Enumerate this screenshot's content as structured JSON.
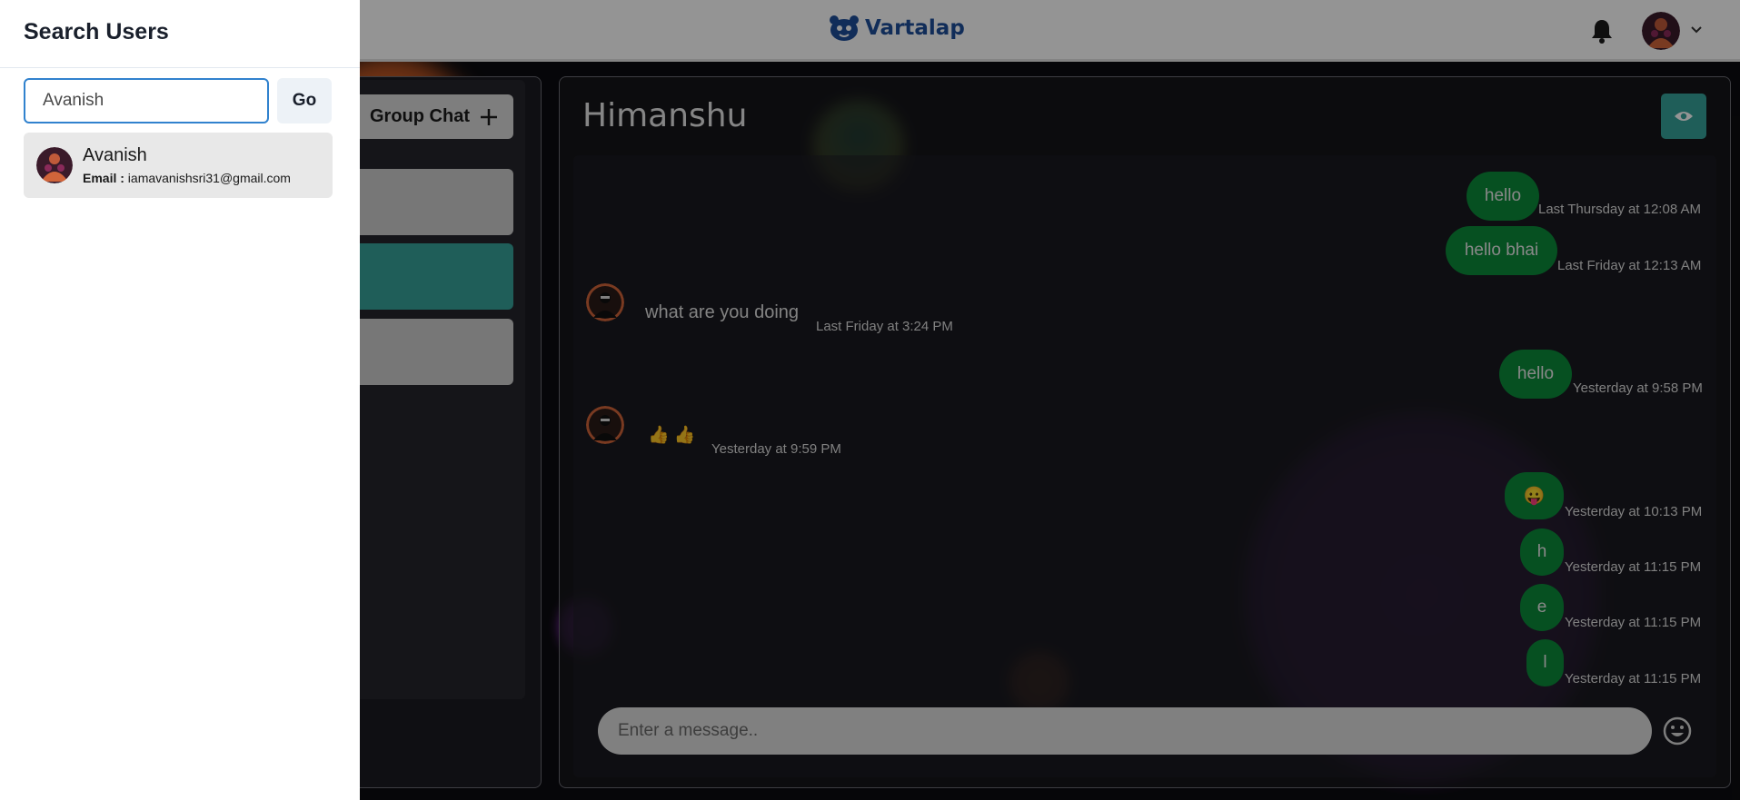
{
  "header": {
    "brand_name": "Vartalap",
    "logo_icon": "mascot-logo-icon",
    "notification_icon": "bell-icon",
    "profile_icon": "avatar",
    "menu_icon": "chevron-down-icon"
  },
  "left_panel": {
    "group_chat_label": "Group Chat",
    "group_chat_icon": "plus-icon"
  },
  "chat": {
    "title": "Himanshu",
    "view_profile_icon": "eye-icon",
    "messages": [
      {
        "direction": "sent",
        "text": "hello",
        "time": "Last Thursday at 12:08 AM"
      },
      {
        "direction": "sent",
        "text": "hello bhai",
        "time": "Last Friday at 12:13 AM"
      },
      {
        "direction": "received",
        "text": "what are you doing",
        "time": "Last Friday at 3:24 PM"
      },
      {
        "direction": "sent",
        "text": "hello",
        "time": "Yesterday at 9:58 PM"
      },
      {
        "direction": "received",
        "text": "👍 👍",
        "time": "Yesterday at 9:59 PM"
      },
      {
        "direction": "sent",
        "text": "😛",
        "time": "Yesterday at 10:13 PM"
      },
      {
        "direction": "sent",
        "text": "h",
        "time": "Yesterday at 11:15 PM"
      },
      {
        "direction": "sent",
        "text": "e",
        "time": "Yesterday at 11:15 PM"
      },
      {
        "direction": "sent",
        "text": "l",
        "time": "Yesterday at 11:15 PM"
      }
    ],
    "input_placeholder": "Enter a message..",
    "emoji_icon": "smiley-icon"
  },
  "drawer": {
    "title": "Search Users",
    "search_value": "Avanish",
    "go_label": "Go",
    "results": [
      {
        "name": "Avanish",
        "email_label": "Email :",
        "email": "iamavanishsri31@gmail.com"
      }
    ]
  },
  "colors": {
    "brand": "#1e4e9a",
    "accent_teal": "#36a39a",
    "sent_bubble": "#0c8a3a",
    "focus_border": "#3182ce"
  }
}
